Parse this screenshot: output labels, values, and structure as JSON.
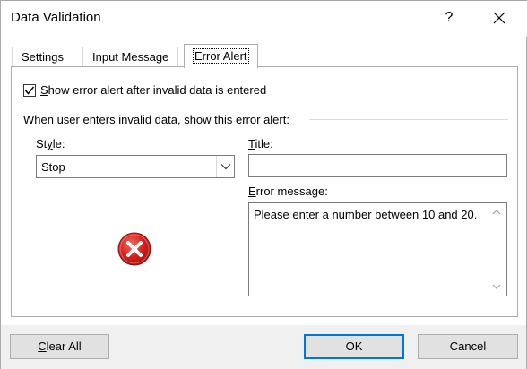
{
  "window": {
    "title": "Data Validation",
    "help_label": "?",
    "close_icon": "close-icon"
  },
  "tabs": [
    {
      "label": "Settings",
      "active": false
    },
    {
      "label": "Input Message",
      "active": false
    },
    {
      "label": "Error Alert",
      "active": true
    }
  ],
  "error_alert": {
    "show_alert": {
      "checked": true,
      "label_underlined": "S",
      "label_rest": "how error alert after invalid data is entered"
    },
    "group_label": "When user enters invalid data, show this error alert:",
    "style": {
      "label_prefix": "St",
      "label_underlined": "y",
      "label_suffix": "le:",
      "value": "Stop",
      "icon": "error-stop-icon"
    },
    "title": {
      "label_underlined": "T",
      "label_rest": "itle:",
      "value": ""
    },
    "error_message": {
      "label_underlined": "E",
      "label_rest": "rror message:",
      "value": "Please enter a number between 10 and 20."
    }
  },
  "footer": {
    "clear_underlined": "C",
    "clear_rest": "lear All",
    "ok_label": "OK",
    "cancel_label": "Cancel"
  },
  "colors": {
    "accent": "#0078d7",
    "error_icon": "#d9201e",
    "footer_bg": "#f0f0f0"
  }
}
